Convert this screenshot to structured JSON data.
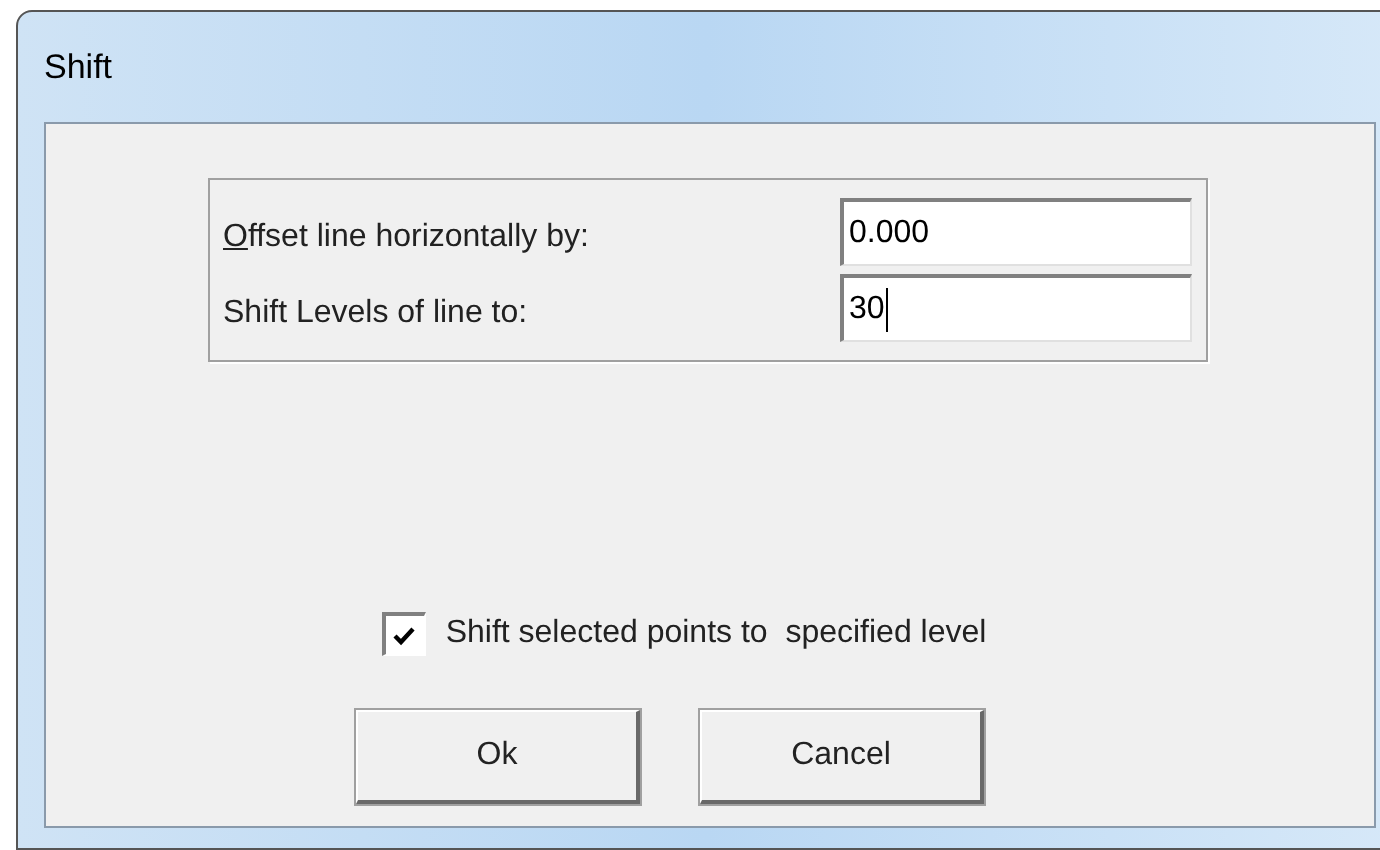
{
  "window": {
    "title": "Shift"
  },
  "fields": [
    {
      "label": "Offset line horizontally by:",
      "mnemonic": true,
      "value": "0.000",
      "focused": false
    },
    {
      "label": "Shift Levels of line to:",
      "mnemonic": false,
      "value": "30",
      "focused": true
    }
  ],
  "checkbox": {
    "label": "Shift selected points to  specified level",
    "checked": true
  },
  "buttons": [
    "Ok",
    "Cancel"
  ]
}
